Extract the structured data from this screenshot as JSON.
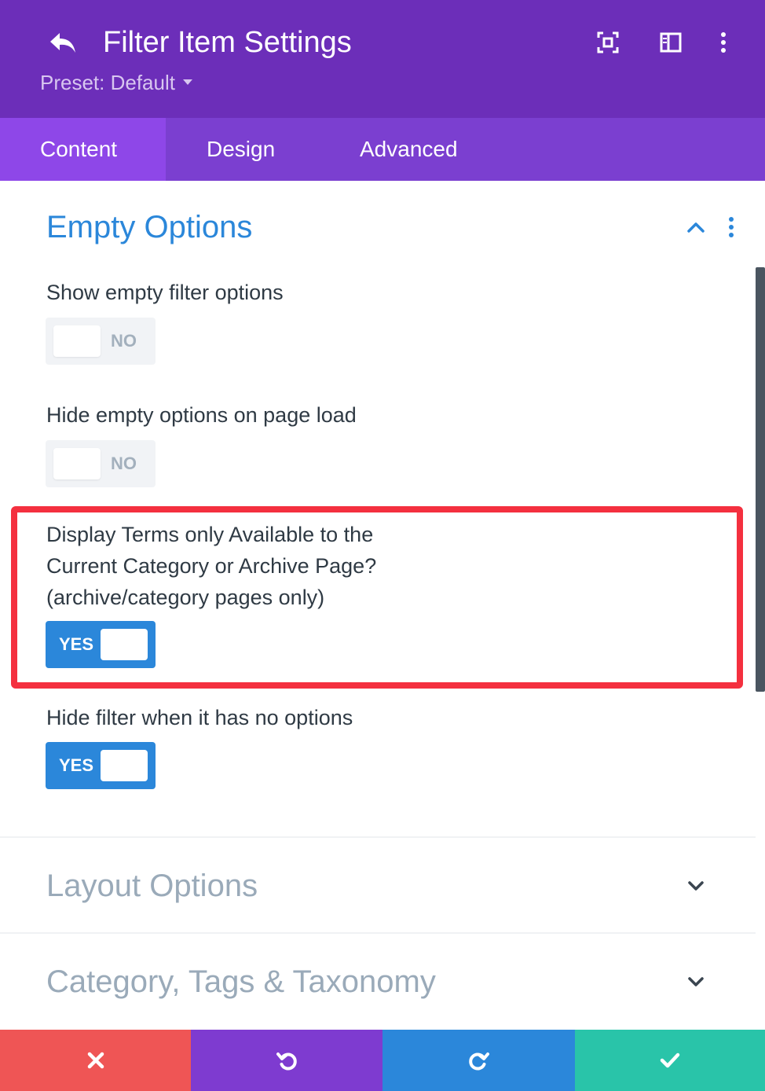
{
  "header": {
    "title": "Filter Item Settings",
    "preset_label": "Preset: Default",
    "background": "#6c2eb9"
  },
  "tabs": [
    {
      "label": "Content",
      "active": true
    },
    {
      "label": "Design",
      "active": false
    },
    {
      "label": "Advanced",
      "active": false
    }
  ],
  "sections": {
    "empty_options": {
      "title": "Empty Options",
      "expanded": true,
      "fields": [
        {
          "label": "Show empty filter options",
          "value": "NO"
        },
        {
          "label": "Hide empty options on page load",
          "value": "NO"
        },
        {
          "label_lines": [
            "Display Terms only Available to the",
            "Current Category or Archive Page?",
            "(archive/category pages only)"
          ],
          "value": "YES",
          "highlighted": true
        },
        {
          "label": "Hide filter when it has no options",
          "value": "YES"
        }
      ]
    },
    "layout_options": {
      "title": "Layout Options",
      "expanded": false
    },
    "taxonomy": {
      "title": "Category, Tags & Taxonomy",
      "expanded": false
    }
  },
  "footer": {
    "buttons": [
      {
        "icon": "close-icon",
        "color": "#ef5555"
      },
      {
        "icon": "undo-icon",
        "color": "#7e3bd0"
      },
      {
        "icon": "redo-icon",
        "color": "#2b87da"
      },
      {
        "icon": "check-icon",
        "color": "#29c4a9"
      }
    ]
  },
  "colors": {
    "accent_blue": "#2b87da",
    "highlight_red": "#f4303f",
    "tab_bar": "#7b3fd0",
    "tab_active": "#8e47e8"
  }
}
